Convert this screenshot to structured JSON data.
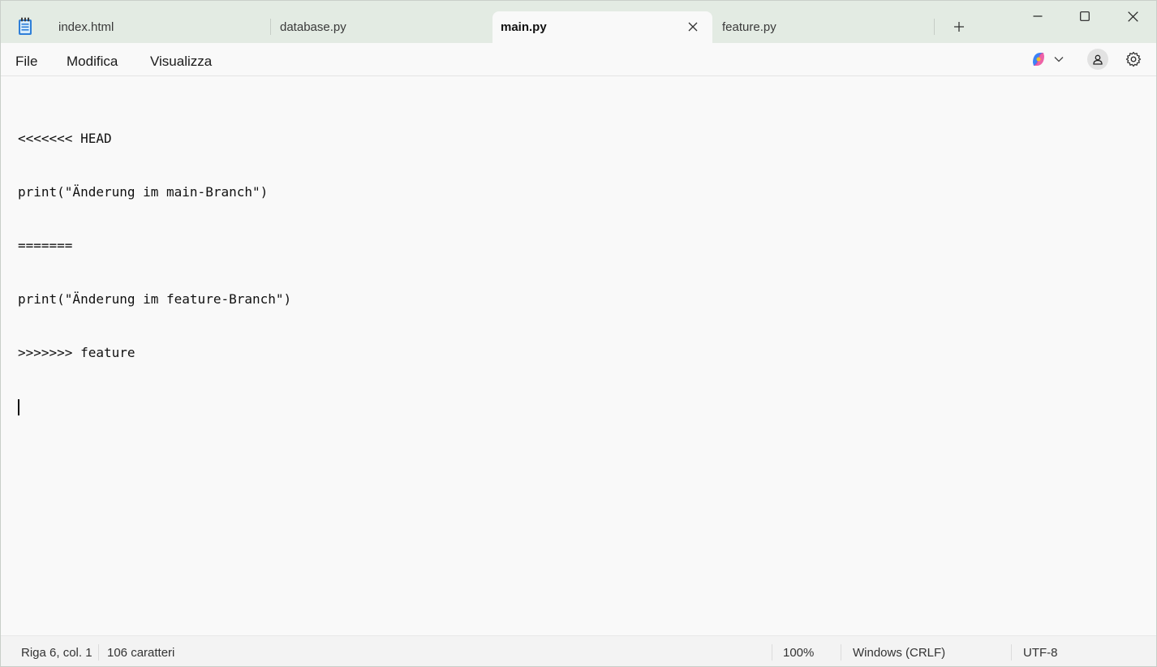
{
  "tabs": [
    {
      "label": "index.html",
      "active": false
    },
    {
      "label": "database.py",
      "active": false
    },
    {
      "label": "main.py",
      "active": true
    },
    {
      "label": "feature.py",
      "active": false
    }
  ],
  "menu": {
    "file": "File",
    "edit": "Modifica",
    "view": "Visualizza"
  },
  "editor": {
    "lines": [
      "<<<<<<< HEAD",
      "print(\"Änderung im main-Branch\")",
      "=======",
      "print(\"Änderung im feature-Branch\")",
      ">>>>>>> feature",
      ""
    ]
  },
  "status": {
    "position": "Riga 6, col. 1",
    "chars": "106 caratteri",
    "zoom": "100%",
    "line_ending": "Windows (CRLF)",
    "encoding": "UTF-8"
  },
  "icons": {
    "app": "notepad-icon",
    "close_tab": "close-icon",
    "new_tab": "plus-icon",
    "minimize": "minimize-icon",
    "maximize": "maximize-icon",
    "close_window": "close-icon",
    "copilot": "copilot-icon",
    "dropdown": "chevron-down-icon",
    "account": "account-icon",
    "settings": "gear-icon"
  },
  "colors": {
    "titlebar": "#e3ebe3",
    "background": "#f9f9f9",
    "accent": "#2b6fd6"
  }
}
